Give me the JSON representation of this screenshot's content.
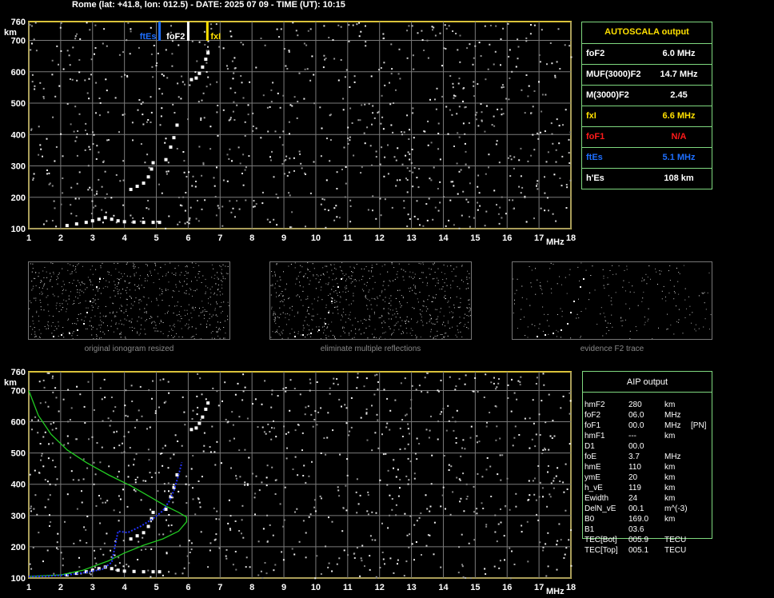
{
  "header": "Rome (lat: +41.8, lon: 012.5) - DATE: 2025 07 09 - TIME (UT): 10:15",
  "colors": {
    "grid": "#7a7a7a",
    "frame": "#d9c23a",
    "table_border": "#7fd87f",
    "ftes": "#1e6fff",
    "fxi": "#ffe000",
    "fof1": "#ff1a1a",
    "green_profile": "#22cc22",
    "blue_fit": "#2233ff"
  },
  "chart_data": [
    {
      "type": "scatter",
      "title": "",
      "xlabel": "MHz",
      "ylabel": "km",
      "xlim": [
        1,
        18
      ],
      "ylim": [
        100,
        760
      ],
      "x_ticks": [
        "1",
        "2",
        "3",
        "4",
        "5",
        "6",
        "7",
        "8",
        "9",
        "10",
        "11",
        "12",
        "13",
        "14",
        "15",
        "16",
        "17",
        "18"
      ],
      "y_ticks": [
        "100",
        "200",
        "300",
        "400",
        "500",
        "600",
        "700",
        "760"
      ],
      "grid": true,
      "markers": [
        {
          "label": "ftEs",
          "x": 5.1,
          "color": "#1e6fff"
        },
        {
          "label": "foF2",
          "x": 6.0,
          "color": "#ffffff"
        },
        {
          "label": "fxI",
          "x": 6.6,
          "color": "#ffe000"
        }
      ],
      "series": [
        {
          "points": [
            [
              2.2,
              110
            ],
            [
              2.5,
              115
            ],
            [
              2.8,
              120
            ],
            [
              3.0,
              125
            ],
            [
              3.2,
              130
            ],
            [
              3.4,
              135
            ],
            [
              3.6,
              130
            ],
            [
              3.8,
              125
            ],
            [
              4.0,
              122
            ],
            [
              4.3,
              121
            ],
            [
              4.6,
              120
            ],
            [
              4.9,
              120
            ],
            [
              5.1,
              120
            ]
          ]
        },
        {
          "points": [
            [
              4.2,
              225
            ],
            [
              4.4,
              235
            ],
            [
              4.6,
              245
            ],
            [
              4.75,
              265
            ],
            [
              4.85,
              290
            ],
            [
              4.9,
              310
            ]
          ]
        },
        {
          "points": [
            [
              5.3,
              320
            ],
            [
              5.45,
              360
            ],
            [
              5.55,
              390
            ],
            [
              5.65,
              430
            ]
          ]
        },
        {
          "points": [
            [
              6.1,
              575
            ],
            [
              6.25,
              580
            ],
            [
              6.35,
              595
            ],
            [
              6.45,
              615
            ],
            [
              6.55,
              640
            ],
            [
              6.62,
              660
            ]
          ]
        }
      ]
    },
    {
      "type": "line",
      "title": "",
      "xlabel": "MHz",
      "ylabel": "km",
      "xlim": [
        1,
        18
      ],
      "ylim": [
        100,
        760
      ],
      "x_ticks": [
        "1",
        "2",
        "3",
        "4",
        "5",
        "6",
        "7",
        "8",
        "9",
        "10",
        "11",
        "12",
        "13",
        "14",
        "15",
        "16",
        "17",
        "18"
      ],
      "y_ticks": [
        "100",
        "200",
        "300",
        "400",
        "500",
        "600",
        "700",
        "760"
      ],
      "grid": true,
      "series": [
        {
          "color": "#22cc22",
          "points": [
            [
              1.0,
              700
            ],
            [
              1.3,
              620
            ],
            [
              1.7,
              560
            ],
            [
              2.2,
              510
            ],
            [
              2.8,
              470
            ],
            [
              3.5,
              430
            ],
            [
              4.2,
              395
            ],
            [
              4.8,
              360
            ],
            [
              5.3,
              330
            ],
            [
              5.7,
              310
            ],
            [
              5.95,
              295
            ],
            [
              5.95,
              280
            ],
            [
              5.7,
              250
            ],
            [
              5.2,
              225
            ],
            [
              4.6,
              205
            ],
            [
              4.0,
              180
            ],
            [
              3.5,
              155
            ],
            [
              2.7,
              125
            ],
            [
              2.0,
              110
            ],
            [
              1.0,
              105
            ]
          ]
        },
        {
          "color": "#2233ff",
          "points": [
            [
              1.0,
              105
            ],
            [
              1.6,
              106
            ],
            [
              2.2,
              110
            ],
            [
              2.8,
              118
            ],
            [
              3.3,
              128
            ],
            [
              3.6,
              150
            ],
            [
              3.8,
              250
            ],
            [
              4.1,
              245
            ],
            [
              4.5,
              265
            ],
            [
              4.9,
              290
            ],
            [
              5.2,
              315
            ],
            [
              5.4,
              345
            ],
            [
              5.55,
              380
            ],
            [
              5.7,
              430
            ],
            [
              5.8,
              470
            ]
          ]
        }
      ]
    }
  ],
  "autoscala": {
    "title": "AUTOSCALA output",
    "rows": [
      {
        "label": "foF2",
        "value": "6.0 MHz",
        "color": "#ffffff"
      },
      {
        "label": "MUF(3000)F2",
        "value": "14.7 MHz",
        "color": "#ffffff"
      },
      {
        "label": "M(3000)F2",
        "value": "2.45",
        "color": "#ffffff"
      },
      {
        "label": "fxI",
        "value": "6.6 MHz",
        "color": "#ffe000"
      },
      {
        "label": "foF1",
        "value": "N/A",
        "color": "#ff1a1a"
      },
      {
        "label": "ftEs",
        "value": "5.1 MHz",
        "color": "#1e6fff"
      },
      {
        "label": "h'Es",
        "value": "108    km",
        "color": "#ffffff"
      }
    ]
  },
  "thumbnails": [
    {
      "caption": "original ionogram resized"
    },
    {
      "caption": "eliminate multiple reflections"
    },
    {
      "caption": "evidence F2 trace"
    }
  ],
  "aip": {
    "title": "AIP output",
    "rows": [
      {
        "name": "hmF2",
        "value": "280",
        "unit": "km",
        "extra": ""
      },
      {
        "name": "foF2",
        "value": "06.0",
        "unit": "MHz",
        "extra": ""
      },
      {
        "name": "foF1",
        "value": "00.0",
        "unit": "MHz",
        "extra": "[PN]"
      },
      {
        "name": "hmF1",
        "value": "---",
        "unit": "km",
        "extra": ""
      },
      {
        "name": "D1",
        "value": "00.0",
        "unit": "",
        "extra": ""
      },
      {
        "name": "foE",
        "value": "3.7",
        "unit": "MHz",
        "extra": ""
      },
      {
        "name": "hmE",
        "value": "110",
        "unit": "km",
        "extra": ""
      },
      {
        "name": "ymE",
        "value": "20",
        "unit": "km",
        "extra": ""
      },
      {
        "name": "h_vE",
        "value": "119",
        "unit": "km",
        "extra": ""
      },
      {
        "name": "Ewidth",
        "value": "24",
        "unit": "km",
        "extra": ""
      },
      {
        "name": "DelN_vE",
        "value": "00.1",
        "unit": "m^(-3)",
        "extra": ""
      },
      {
        "name": "B0",
        "value": "169.0",
        "unit": "km",
        "extra": ""
      },
      {
        "name": "B1",
        "value": "03.6",
        "unit": "",
        "extra": ""
      },
      {
        "name": "TEC[Bot]",
        "value": "005.9",
        "unit": "TECU",
        "extra": ""
      },
      {
        "name": "TEC[Top]",
        "value": "005.1",
        "unit": "TECU",
        "extra": ""
      }
    ]
  }
}
